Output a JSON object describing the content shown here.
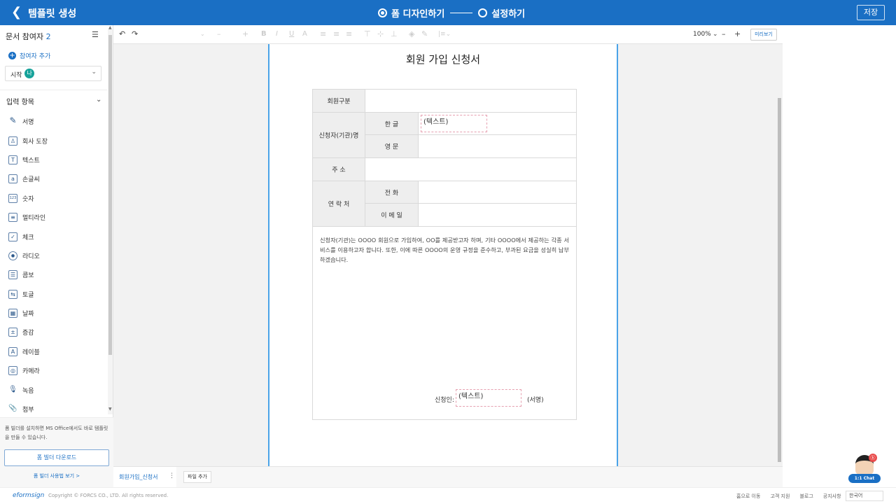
{
  "header": {
    "title": "템플릿 생성",
    "steps": [
      "폼 디자인하기",
      "설정하기"
    ],
    "save_label": "저장"
  },
  "sidebar": {
    "participants_label": "문서 참여자",
    "participants_count": "2",
    "add_participant": "참여자 추가",
    "select_label": "시작",
    "select_avatar": "나",
    "section_title": "입력 항목",
    "items": [
      {
        "label": "서명",
        "icon": "✎"
      },
      {
        "label": "회사 도장",
        "icon": "♙"
      },
      {
        "label": "텍스트",
        "icon": "T"
      },
      {
        "label": "손글씨",
        "icon": "a"
      },
      {
        "label": "숫자",
        "icon": "123"
      },
      {
        "label": "멀티라인",
        "icon": "≡"
      },
      {
        "label": "체크",
        "icon": "✓"
      },
      {
        "label": "라디오",
        "icon": "●"
      },
      {
        "label": "콤보",
        "icon": "☰"
      },
      {
        "label": "토글",
        "icon": "⇆"
      },
      {
        "label": "날짜",
        "icon": "▦"
      },
      {
        "label": "증감",
        "icon": "±"
      },
      {
        "label": "레이블",
        "icon": "A"
      },
      {
        "label": "카메라",
        "icon": "◎"
      },
      {
        "label": "녹음",
        "icon": "🎙"
      },
      {
        "label": "첨부",
        "icon": "📎"
      }
    ],
    "note": "폼 빌더를 설치하면 MS Office에서도 바로 템플릿을 만들 수 있습니다.",
    "download_button": "폼 빌더 다운로드",
    "guide_link": "폼 빌더 사용법 보기 >"
  },
  "toolbar": {
    "zoom": "100%",
    "preview": "미리보기"
  },
  "document": {
    "title": "회원 가입 신청서",
    "rows": {
      "member_type": "회원구분",
      "applicant_name": "신청자(기관)명",
      "korean": "한   글",
      "english": "영   문",
      "address": "주   소",
      "contact": "연 락 처",
      "phone": "전   화",
      "email": "이 메 일"
    },
    "text_field_placeholder": "(텍스트)",
    "body": "신청자(기관)는 OOOO 회원으로 가입하여, OO를 제공받고자 하며, 기타 OOOO에서 제공하는 각종 서비스를 이용하고자 합니다. 또한, 이에 따른 OOOO의 운영 규정을 준수하고, 부과된 요금을 성실히 납부하겠습니다.",
    "applicant_label": "신청인:",
    "sign_label": "(서명)"
  },
  "tabs": {
    "active": "회원가입_신청서",
    "add": "파일 추가"
  },
  "footer": {
    "logo": "eformsign",
    "copyright": "Copyright © FORCS CO., LTD. All rights reserved.",
    "links": [
      "홈으로 이동",
      "고객 지원",
      "블로그",
      "공지사항"
    ],
    "language": "한국어"
  },
  "chat": {
    "label": "1:1 Chat",
    "badge": "ⓚ"
  },
  "colors": {
    "brand": "#1a6fc4",
    "page_border": "#4aa3e8",
    "header_cell": "#eeeeee"
  }
}
